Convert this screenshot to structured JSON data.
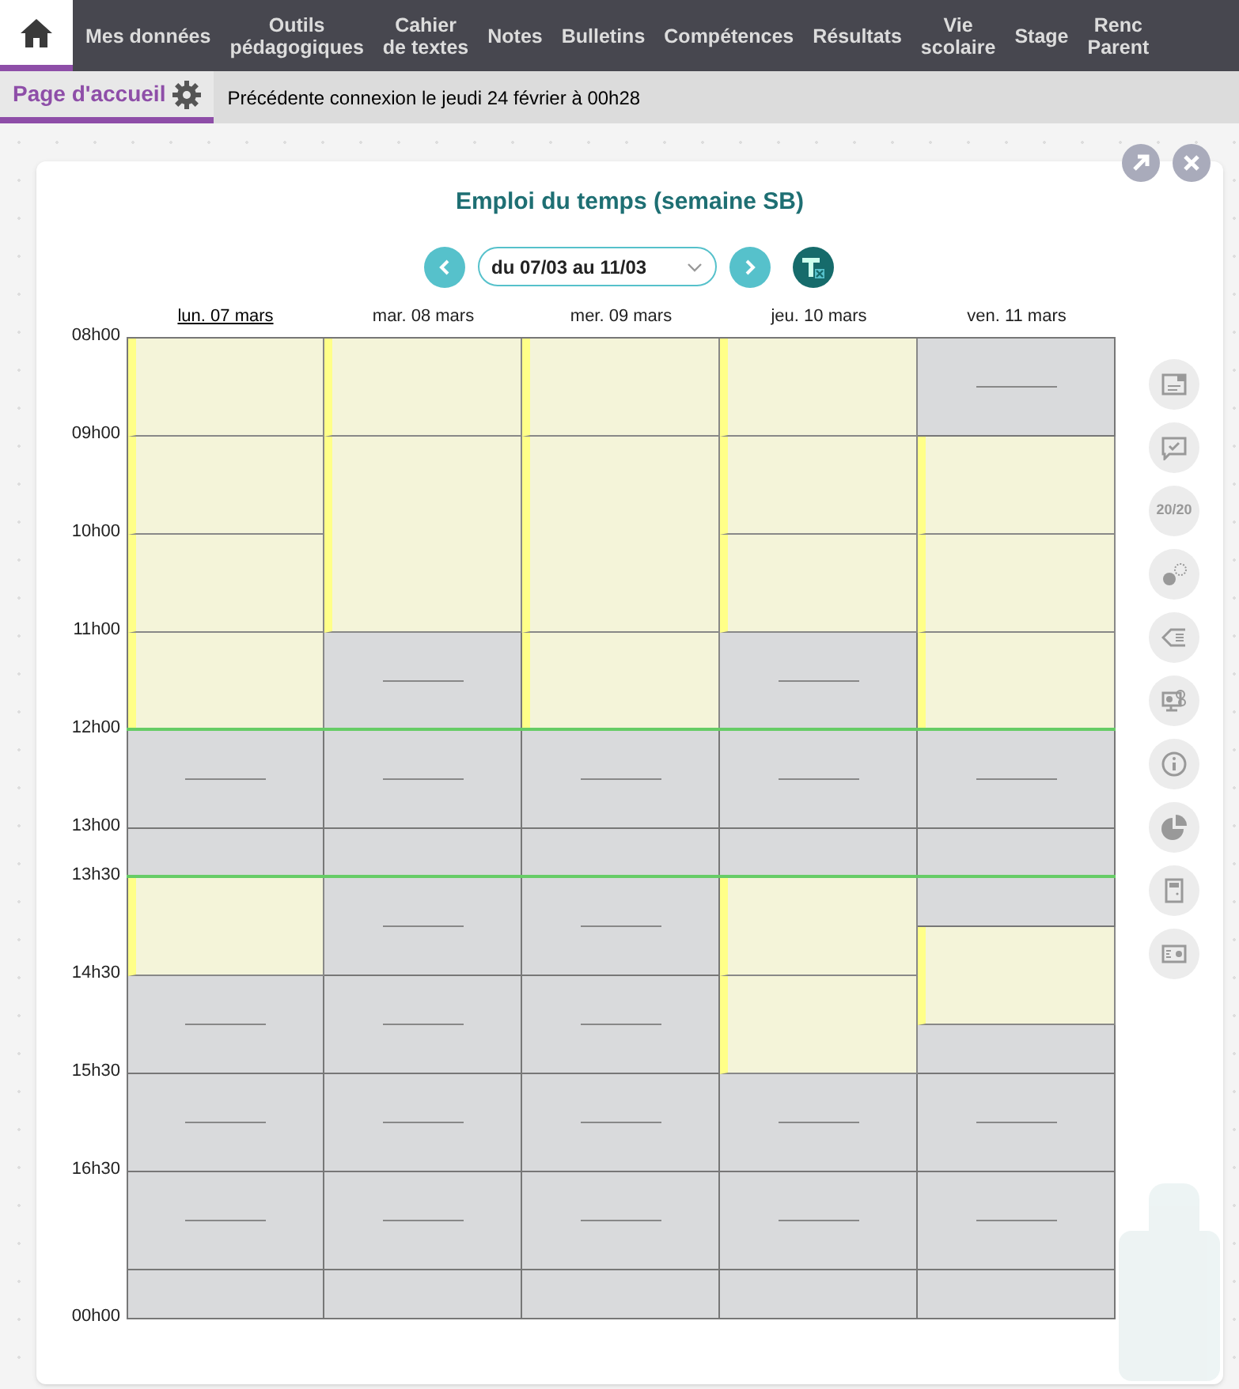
{
  "nav": {
    "home": {
      "selected": true
    },
    "items": [
      {
        "label": "Mes données",
        "selected": false
      },
      {
        "label": "Outils\npédagogiques",
        "selected": false
      },
      {
        "label": "Cahier\nde textes",
        "selected": false
      },
      {
        "label": "Notes",
        "selected": false
      },
      {
        "label": "Bulletins",
        "selected": false
      },
      {
        "label": "Compétences",
        "selected": false
      },
      {
        "label": "Résultats",
        "selected": false
      },
      {
        "label": "Vie\nscolaire",
        "selected": false
      },
      {
        "label": "Stage",
        "selected": false
      },
      {
        "label": "Renc\nParent",
        "selected": false
      }
    ]
  },
  "subbar": {
    "tab": {
      "label": "Page d'accueil",
      "selected": true
    },
    "last_login": "Précédente connexion le jeudi 24 février à 00h28"
  },
  "widget": {
    "title": "Emploi du temps (semaine SB)",
    "week_select": {
      "value": "du 07/03 au 11/03"
    },
    "time_rows": [
      {
        "label": "08h00",
        "kind": "hour"
      },
      {
        "label": "09h00",
        "kind": "hour"
      },
      {
        "label": "10h00",
        "kind": "hour"
      },
      {
        "label": "11h00",
        "kind": "hour"
      },
      {
        "label": "12h00",
        "kind": "hour"
      },
      {
        "label": "13h00",
        "kind": "half"
      },
      {
        "label": "13h30",
        "kind": "hour"
      },
      {
        "label": "14h30",
        "kind": "hour"
      },
      {
        "label": "15h30",
        "kind": "hour"
      },
      {
        "label": "16h30",
        "kind": "hour"
      },
      {
        "kind": "half"
      }
    ],
    "end_label": "00h00",
    "days": [
      {
        "label": "lun. 07 mars",
        "selected": true,
        "slots": [
          {
            "kind": "lesson"
          },
          {
            "kind": "lesson"
          },
          {
            "kind": "lesson"
          },
          {
            "kind": "lesson"
          },
          {
            "kind": "free_hour"
          },
          {
            "kind": "free_half"
          },
          {
            "kind": "lesson"
          },
          {
            "kind": "free_hour"
          },
          {
            "kind": "free_hour"
          },
          {
            "kind": "free_hour"
          },
          {
            "kind": "free_half"
          }
        ]
      },
      {
        "label": "mar. 08 mars",
        "selected": false,
        "slots": [
          {
            "kind": "lesson"
          },
          {
            "kind": "double_lesson"
          },
          {
            "kind": "free_hour"
          },
          {
            "kind": "free_hour"
          },
          {
            "kind": "free_half"
          },
          {
            "kind": "free_hour"
          },
          {
            "kind": "free_hour"
          },
          {
            "kind": "free_hour"
          },
          {
            "kind": "free_hour"
          },
          {
            "kind": "free_half"
          }
        ]
      },
      {
        "label": "mer. 09 mars",
        "selected": false,
        "slots": [
          {
            "kind": "lesson"
          },
          {
            "kind": "double_lesson"
          },
          {
            "kind": "lesson"
          },
          {
            "kind": "free_hour"
          },
          {
            "kind": "free_half"
          },
          {
            "kind": "free_hour"
          },
          {
            "kind": "free_hour"
          },
          {
            "kind": "free_hour"
          },
          {
            "kind": "free_hour"
          },
          {
            "kind": "free_half"
          }
        ]
      },
      {
        "label": "jeu. 10 mars",
        "selected": false,
        "slots": [
          {
            "kind": "lesson"
          },
          {
            "kind": "lesson"
          },
          {
            "kind": "lesson"
          },
          {
            "kind": "free_hour"
          },
          {
            "kind": "free_hour"
          },
          {
            "kind": "free_half"
          },
          {
            "kind": "lesson"
          },
          {
            "kind": "lesson"
          },
          {
            "kind": "free_hour"
          },
          {
            "kind": "free_hour"
          },
          {
            "kind": "free_half"
          }
        ]
      },
      {
        "label": "ven. 11 mars",
        "selected": false,
        "slots": [
          {
            "kind": "free_hour"
          },
          {
            "kind": "lesson"
          },
          {
            "kind": "lesson"
          },
          {
            "kind": "lesson"
          },
          {
            "kind": "free_hour"
          },
          {
            "kind": "free_half"
          },
          {
            "kind": "free_half"
          },
          {
            "kind": "lesson"
          },
          {
            "kind": "free_half"
          },
          {
            "kind": "free_hour"
          },
          {
            "kind": "free_hour"
          },
          {
            "kind": "free_half"
          }
        ]
      }
    ],
    "side_tools": [
      {
        "kind": "note"
      },
      {
        "kind": "check"
      },
      {
        "kind": "grades",
        "label": "20/20"
      },
      {
        "kind": "dots"
      },
      {
        "kind": "tag"
      },
      {
        "kind": "monitor"
      },
      {
        "kind": "info"
      },
      {
        "kind": "pie"
      },
      {
        "kind": "door"
      },
      {
        "kind": "card"
      }
    ]
  }
}
